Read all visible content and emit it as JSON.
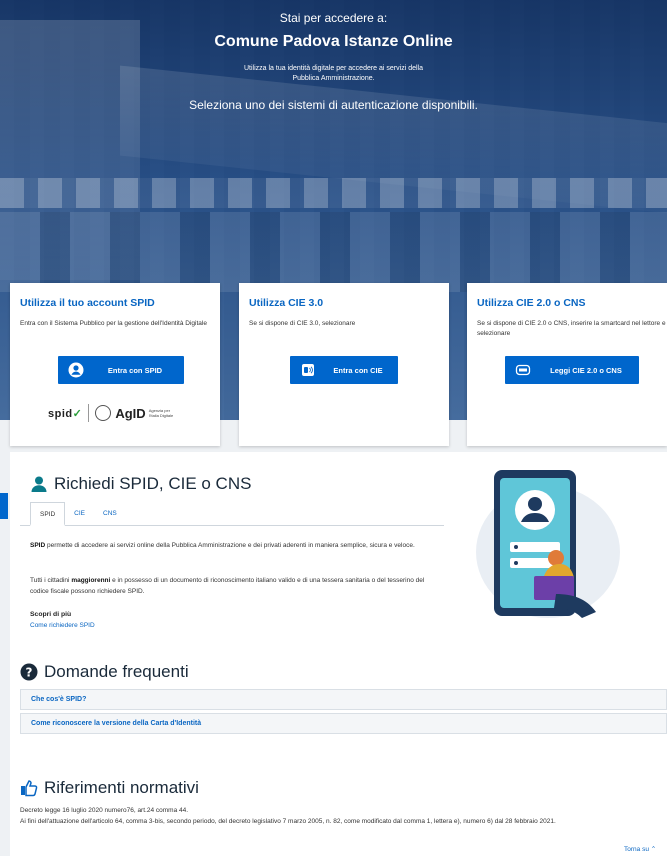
{
  "hero": {
    "lead": "Stai per accedere a:",
    "app_name": "Comune Padova Istanze Online",
    "info": "Utilizza la tua identità digitale per accedere ai servizi della Pubblica Amministrazione.",
    "choose": "Seleziona uno dei sistemi di autenticazione disponibili."
  },
  "cards": [
    {
      "title": "Utilizza il tuo account SPID",
      "text": "Entra con il Sistema Pubblico per la gestione dell'Identità Digitale",
      "button": "Entra con SPID",
      "icon": "user-circle-icon",
      "logos": {
        "spid": "spid",
        "agid": "AgID",
        "agid_sub": "Agenzia per l'Italia Digitale"
      }
    },
    {
      "title": "Utilizza CIE 3.0",
      "text": "Se si dispone di CIE 3.0, selezionare",
      "button": "Entra con CIE",
      "icon": "cie-card-icon"
    },
    {
      "title": "Utilizza CIE 2.0 o CNS",
      "text": "Se si dispone di CIE 2.0 o CNS, inserire la smartcard nel lettore e selezionare",
      "button": "Leggi CIE 2.0 o CNS",
      "icon": "smartcard-reader-icon"
    }
  ],
  "request": {
    "title": "Richiedi SPID, CIE o CNS",
    "tabs": [
      "SPID",
      "CIE",
      "CNS"
    ],
    "p1_bold": "SPID",
    "p1": " permette di accedere ai servizi online della Pubblica Amministrazione e dei privati aderenti in maniera semplice, sicura e veloce.",
    "p2_a": "Tutti i cittadini ",
    "p2_bold": "maggiorenni",
    "p2_b": " e in possesso di un documento di riconoscimento italiano valido e di una tessera sanitaria o del tesserino del codice fiscale possono richiedere SPID.",
    "more_title": "Scopri di più",
    "more_link": "Come richiedere SPID"
  },
  "faq": {
    "title": "Domande frequenti",
    "items": [
      "Che cos'è SPID?",
      "Come riconoscere la versione della Carta d'Identità"
    ]
  },
  "law": {
    "title": "Riferimenti normativi",
    "line1": "Decreto legge 16 luglio 2020 numero76, art.24 comma 44.",
    "line2": "Ai fini dell'attuazione dell'articolo 64, comma 3-bis, secondo periodo, del decreto legislativo 7 marzo 2005, n. 82, come modificato dal comma 1, lettera e), numero 6) dal 28 febbraio 2021."
  },
  "footer": {
    "back_top": "Torna su"
  },
  "colors": {
    "accent": "#0066cc",
    "hero": "#1f3f6e"
  }
}
